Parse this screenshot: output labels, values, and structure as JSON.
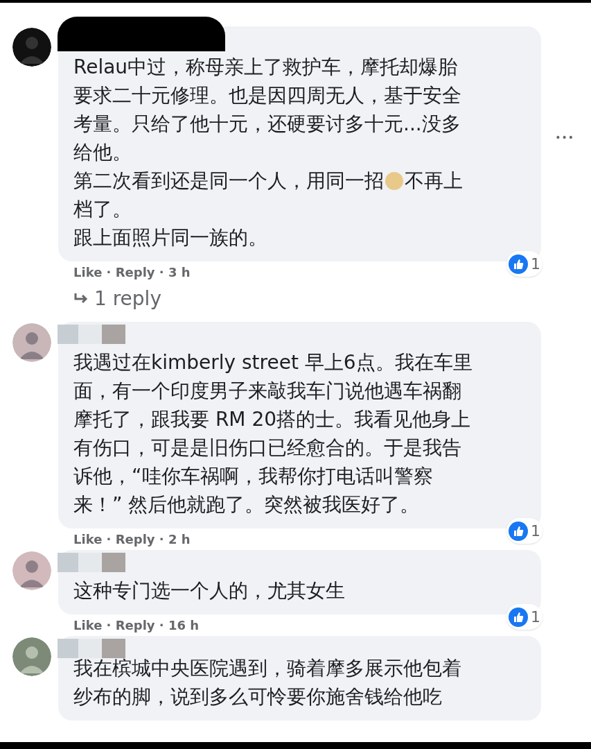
{
  "comments": [
    {
      "lines": [
        "Relau中过，称母亲上了救护车，摩托却爆胎",
        "要求二十元修理。也是因四周无人，基于安全",
        "考量。只给了他十元，还硬要讨多十元...没多",
        "给他。",
        [
          {
            "kind": "text",
            "text": "第二次看到还是同一个人，用同一招"
          },
          {
            "kind": "emoji"
          },
          {
            "kind": "text",
            "text": "不再上"
          }
        ],
        "档了。",
        "跟上面照片同一族的。"
      ],
      "meta": "Like · Reply · 3 h",
      "reactions": "1",
      "replies": "1 reply",
      "menu": "•••"
    },
    {
      "lines": [
        "我遇过在kimberly street 早上6点。我在车里",
        "面，有一个印度男子来敲我车门说他遇车祸翻",
        "摩托了，跟我要 RM 20搭的士。我看见他身上",
        "有伤口，可是是旧伤口已经愈合的。于是我告",
        "诉他，“哇你车祸啊，我帮你打电话叫警察",
        "来！” 然后他就跑了。突然被我医好了。"
      ],
      "meta": "Like · Reply · 2 h",
      "reactions": "1"
    },
    {
      "lines": [
        "这种专门选一个人的，尤其女生"
      ],
      "meta": "Like · Reply · 16 h",
      "reactions": "1"
    },
    {
      "lines": [
        "我在槟城中央医院遇到，骑着摩多展示他包着",
        "纱布的脚，说到多么可怜要你施舍钱给他吃"
      ]
    }
  ]
}
